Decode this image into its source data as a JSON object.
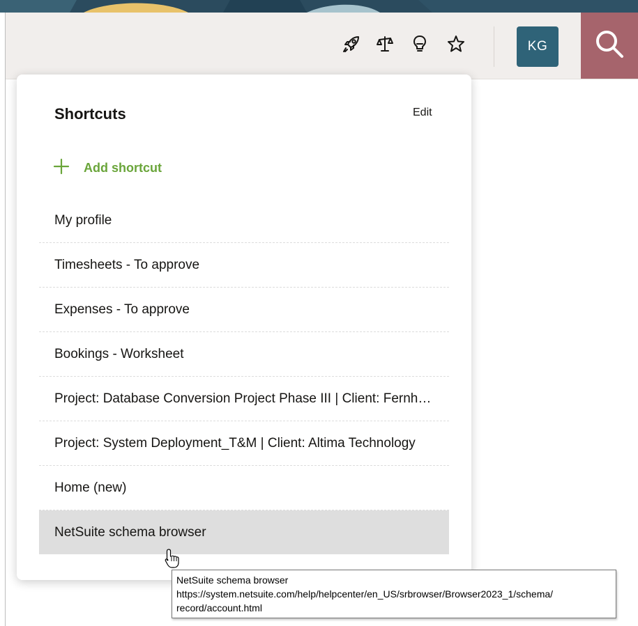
{
  "header": {
    "icons": [
      {
        "name": "rocket-icon"
      },
      {
        "name": "balance-scale-icon"
      },
      {
        "name": "lightbulb-icon"
      },
      {
        "name": "star-icon"
      }
    ],
    "avatar_initials": "KG",
    "search_icon": "search-icon",
    "colors": {
      "header_bg": "#f1eeec",
      "avatar_bg": "#2f6378",
      "search_bg": "#a6646c",
      "banner": "#2b4b5e"
    }
  },
  "shortcuts": {
    "title": "Shortcuts",
    "edit_label": "Edit",
    "add_label": "Add shortcut",
    "accent_color": "#6aa53a",
    "items": [
      {
        "label": "My profile"
      },
      {
        "label": "Timesheets - To approve"
      },
      {
        "label": "Expenses - To approve"
      },
      {
        "label": "Bookings - Worksheet"
      },
      {
        "label": "Project: Database Conversion Project Phase III | Client: Fernh…"
      },
      {
        "label": "Project: System Deployment_T&M | Client: Altima Technology"
      },
      {
        "label": "Home (new)"
      },
      {
        "label": "NetSuite schema browser"
      }
    ],
    "highlighted_index": 7
  },
  "tooltip": {
    "title": "NetSuite schema browser",
    "url_line1": "https://system.netsuite.com/help/helpcenter/en_US/srbrowser/Browser2023_1/schema/",
    "url_line2": "record/account.html"
  }
}
